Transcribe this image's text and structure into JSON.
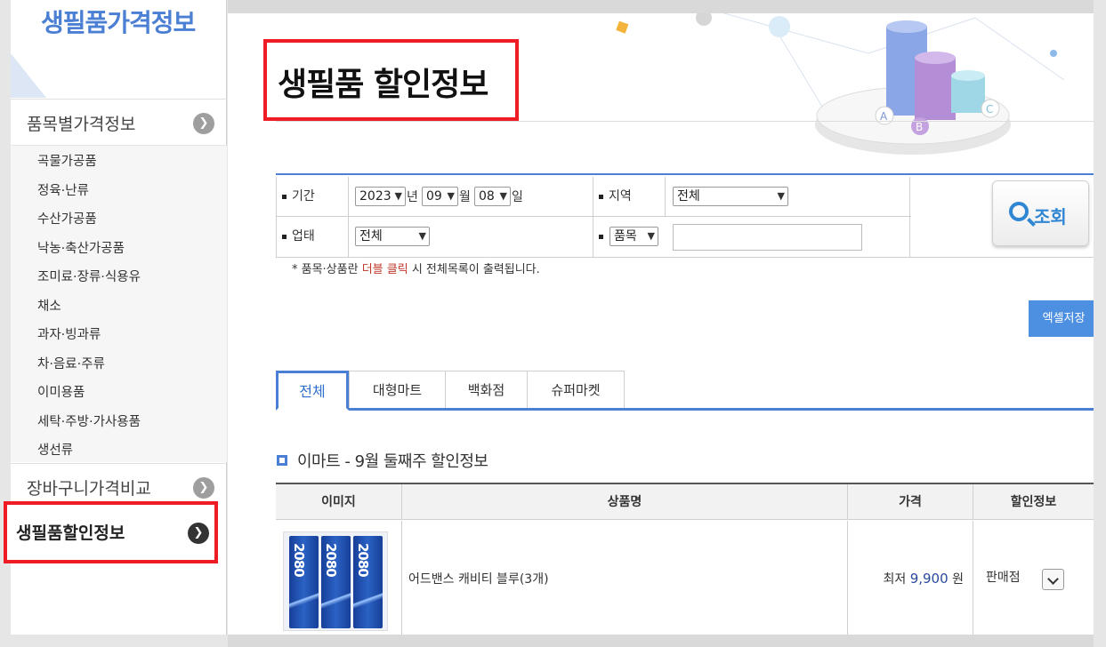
{
  "sidebar": {
    "brand": "생필품가격정보",
    "sections": [
      {
        "label": "품목별가격정보"
      },
      {
        "label": "장바구니가격비교"
      },
      {
        "label": "생필품할인정보"
      }
    ],
    "items": [
      "곡물가공품",
      "정육·난류",
      "수산가공품",
      "낙농·축산가공품",
      "조미료·장류·식용유",
      "채소",
      "과자·빙과류",
      "차·음료·주류",
      "이미용품",
      "세탁·주방·가사용품",
      "생선류"
    ]
  },
  "page": {
    "title": "생필품 할인정보"
  },
  "search": {
    "period_label": "기간",
    "year": "2023",
    "year_unit": "년",
    "month": "09",
    "month_unit": "월",
    "day": "08",
    "day_unit": "일",
    "region_label": "지역",
    "region": "전체",
    "business_label": "업태",
    "business": "전체",
    "category_select": "품목",
    "search_text": "",
    "search_button": "조회",
    "note_prefix": "* 품목·상품란 ",
    "note_highlight": "더블 클릭",
    "note_suffix": " 시 전체목록이 출력됩니다."
  },
  "toolbar": {
    "excel": "엑셀저장"
  },
  "tabs": [
    {
      "label": "전체",
      "active": true
    },
    {
      "label": "대형마트",
      "active": false
    },
    {
      "label": "백화점",
      "active": false
    },
    {
      "label": "슈퍼마켓",
      "active": false
    }
  ],
  "section": {
    "title": "이마트 - 9월 둘째주 할인정보"
  },
  "table": {
    "headers": [
      "이미지",
      "상품명",
      "가격",
      "할인정보"
    ],
    "rows": [
      {
        "image_text": "2080",
        "name": "어드밴스 캐비티 블루(3개)",
        "price_prefix": "최저",
        "price": "9,900",
        "price_unit": "원",
        "discount": "판매점"
      }
    ]
  },
  "hero_labels": [
    "A",
    "B",
    "C"
  ],
  "colors": {
    "accent": "#4a7fd4",
    "highlight_border": "#ee1c25",
    "excel_button": "#4d8fe0",
    "note_highlight": "#c0392b"
  }
}
